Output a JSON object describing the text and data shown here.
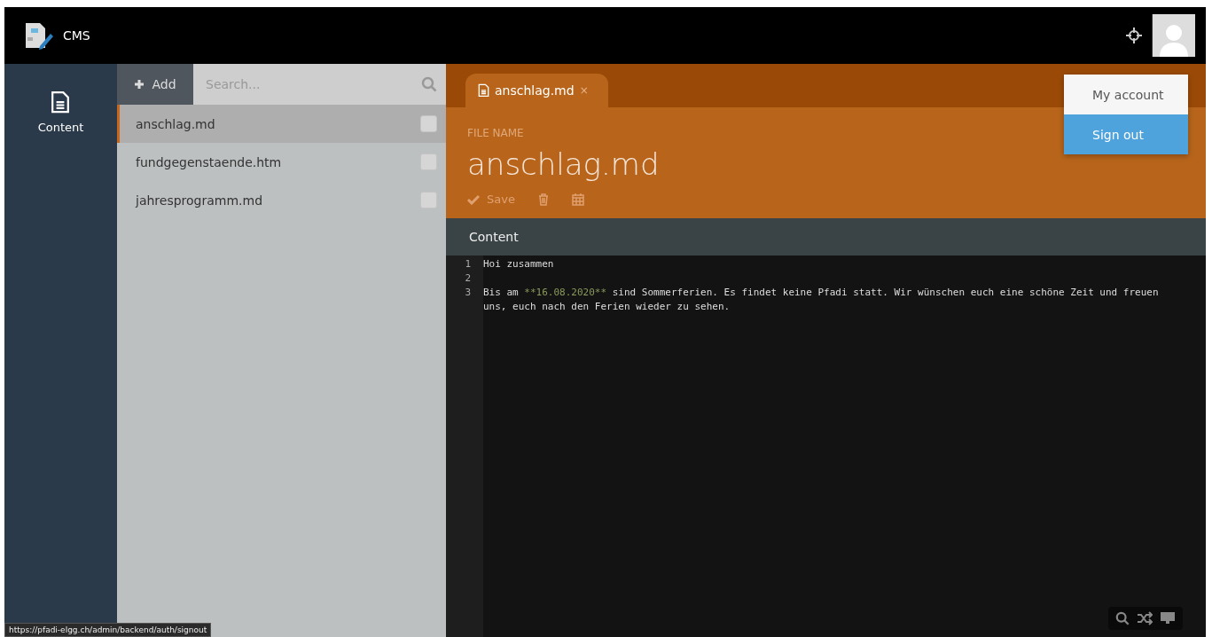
{
  "app": {
    "title": "CMS"
  },
  "nav": [
    {
      "label": "Content",
      "selected": true
    }
  ],
  "list": {
    "add_label": "Add",
    "search_placeholder": "Search...",
    "items": [
      {
        "name": "anschlag.md",
        "selected": true,
        "checked": false
      },
      {
        "name": "fundgegenstaende.htm",
        "selected": false,
        "checked": false
      },
      {
        "name": "jahresprogramm.md",
        "selected": false,
        "checked": false
      }
    ]
  },
  "tabs": [
    {
      "label": "anschlag.md",
      "close": "×",
      "selected": true
    }
  ],
  "editor": {
    "field_label": "FILE NAME",
    "file_name": "anschlag.md",
    "save_label": "Save",
    "section_label": "Content",
    "lines": [
      {
        "number": "1",
        "rows": [
          [
            {
              "text": "Hoi zusammen",
              "kind": "plain"
            }
          ]
        ]
      },
      {
        "number": "2"
      },
      {
        "number": "3",
        "rows": [
          [
            {
              "text": "Bis am ",
              "kind": "plain"
            },
            {
              "text": "**16.08.2020**",
              "kind": "strong"
            },
            {
              "text": " sind Sommerferien. Es findet keine Pfadi statt. Wir wünschen euch eine schöne Zeit und freuen",
              "kind": "plain"
            }
          ],
          [
            {
              "text": "uns, euch nach den Ferien wieder zu sehen.",
              "kind": "plain"
            }
          ]
        ]
      }
    ]
  },
  "menu": [
    {
      "label": "My account",
      "selected": false
    },
    {
      "label": "Sign out",
      "selected": true
    }
  ],
  "status_url": "https://pfadi-elgg.ch/admin/backend/auth/signout"
}
